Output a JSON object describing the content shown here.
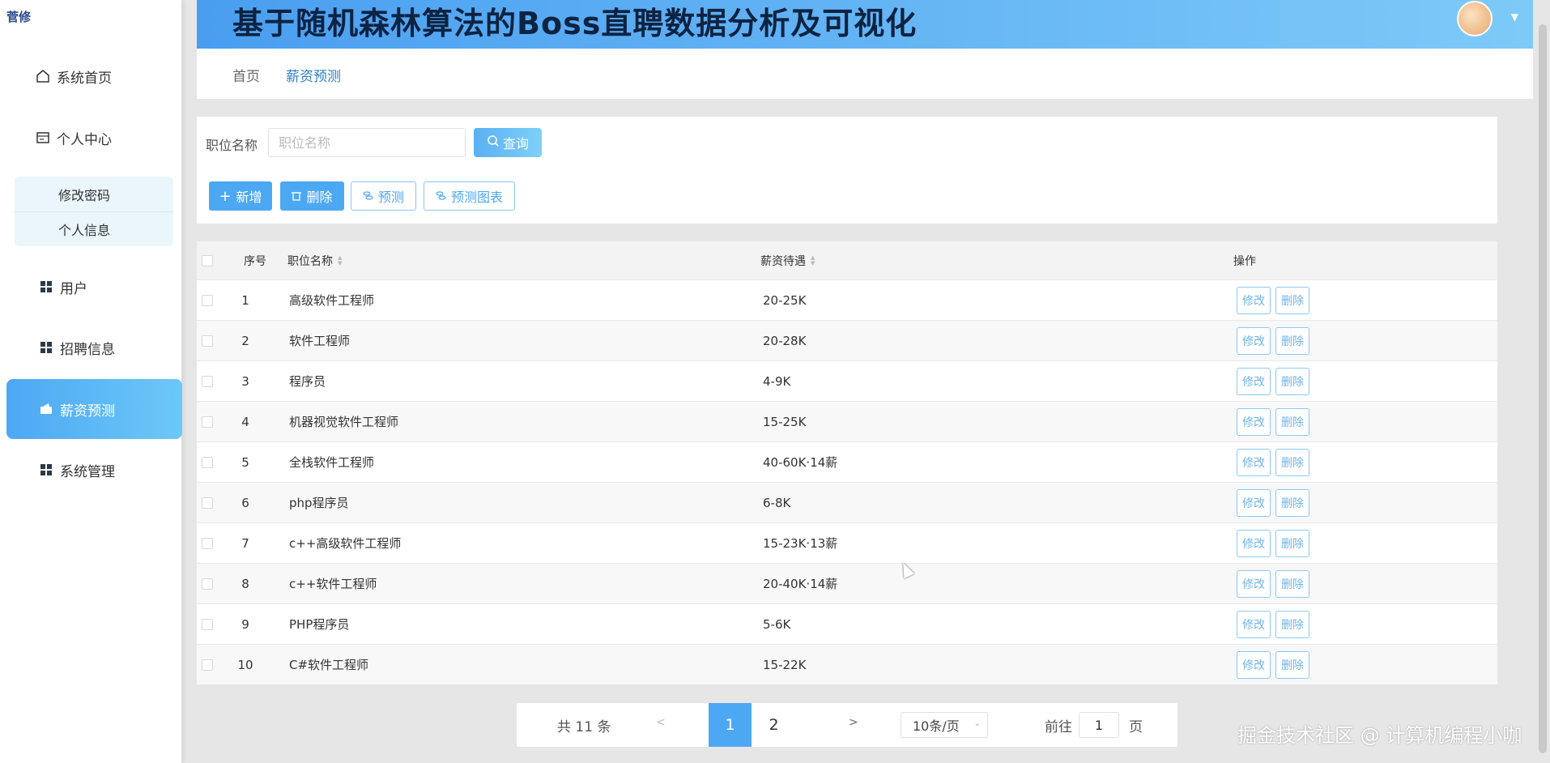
{
  "sidebar": {
    "brand": "菅修",
    "items": [
      {
        "label": "系统首页",
        "icon": "home-icon"
      },
      {
        "label": "个人中心",
        "icon": "id-card-icon"
      },
      {
        "label": "用户",
        "icon": "grid-icon"
      },
      {
        "label": "招聘信息",
        "icon": "grid-icon"
      },
      {
        "label": "薪资预测",
        "icon": "wallet-icon"
      },
      {
        "label": "系统管理",
        "icon": "grid-icon"
      }
    ],
    "sub_items": [
      "修改密码",
      "个人信息"
    ],
    "active": "薪资预测"
  },
  "header": {
    "title": "基于随机森林算法的Boss直聘数据分析及可视化",
    "avatar_icon": "avatar",
    "caret": "▼"
  },
  "breadcrumb": {
    "home": "首页",
    "current": "薪资预测"
  },
  "search": {
    "label": "职位名称",
    "placeholder": "职位名称",
    "query_button": "查询"
  },
  "toolbar": {
    "add": "新增",
    "delete": "删除",
    "predict": "预测",
    "predict_chart": "预测图表"
  },
  "table": {
    "headers": {
      "index": "序号",
      "name": "职位名称",
      "salary": "薪资待遇",
      "ops": "操作"
    },
    "op_edit": "修改",
    "op_delete": "删除",
    "rows": [
      {
        "index": "1",
        "name": "高级软件工程师",
        "salary": "20-25K"
      },
      {
        "index": "2",
        "name": "软件工程师",
        "salary": "20-28K"
      },
      {
        "index": "3",
        "name": "程序员",
        "salary": "4-9K"
      },
      {
        "index": "4",
        "name": "机器视觉软件工程师",
        "salary": "15-25K"
      },
      {
        "index": "5",
        "name": "全栈软件工程师",
        "salary": "40-60K·14薪"
      },
      {
        "index": "6",
        "name": "php程序员",
        "salary": "6-8K"
      },
      {
        "index": "7",
        "name": "c++高级软件工程师",
        "salary": "15-23K·13薪"
      },
      {
        "index": "8",
        "name": "c++软件工程师",
        "salary": "20-40K·14薪"
      },
      {
        "index": "9",
        "name": "PHP程序员",
        "salary": "5-6K"
      },
      {
        "index": "10",
        "name": "C#软件工程师",
        "salary": "15-22K"
      }
    ]
  },
  "pagination": {
    "total": "共 11 条",
    "prev": "<",
    "pages": [
      "1",
      "2"
    ],
    "current": "1",
    "next": ">",
    "page_size": "10条/页",
    "goto_label": "前往",
    "goto_value": "1",
    "page_suffix": "页"
  },
  "watermark": "掘金技术社区 @ 计算机编程小咖",
  "colors": {
    "accent": "#4da8f4",
    "header_start": "#4a9ef0",
    "header_end": "#7dcaf8"
  }
}
